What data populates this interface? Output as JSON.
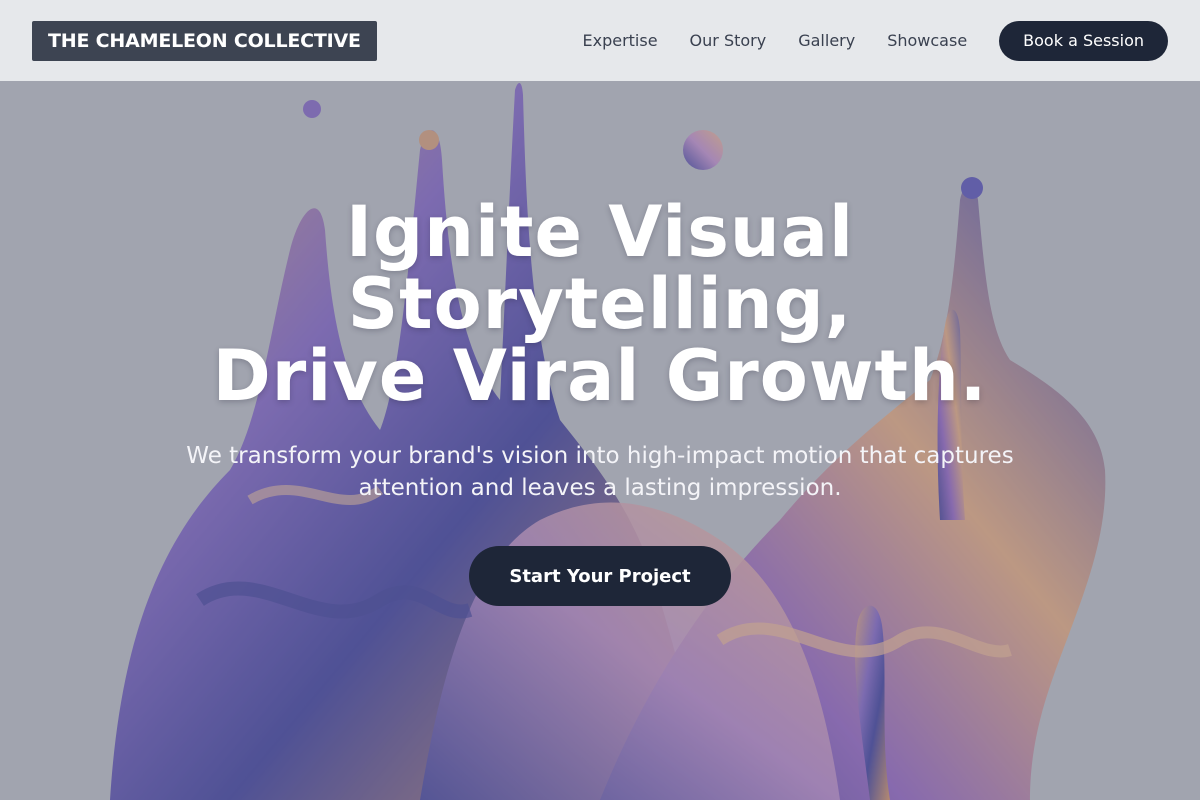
{
  "header": {
    "logo_text": "THE CHAMELEON COLLECTIVE",
    "nav": [
      {
        "label": "Expertise"
      },
      {
        "label": "Our Story"
      },
      {
        "label": "Gallery"
      },
      {
        "label": "Showcase"
      }
    ],
    "cta_label": "Book a Session"
  },
  "hero": {
    "headline_lines": [
      "Ignite Visual",
      "Storytelling,",
      "Drive Viral Growth."
    ],
    "subtitle": "We transform your brand's vision into high-impact motion that captures attention and leaves a lasting impression.",
    "cta_label": "Start Your Project",
    "background_image": "abstract-liquid-splash"
  },
  "colors": {
    "header_bg": "#e9eaed",
    "logo_bg": "#3d4452",
    "button_bg": "#1e2638",
    "nav_text": "#3a4150",
    "hero_text": "#ffffff"
  }
}
